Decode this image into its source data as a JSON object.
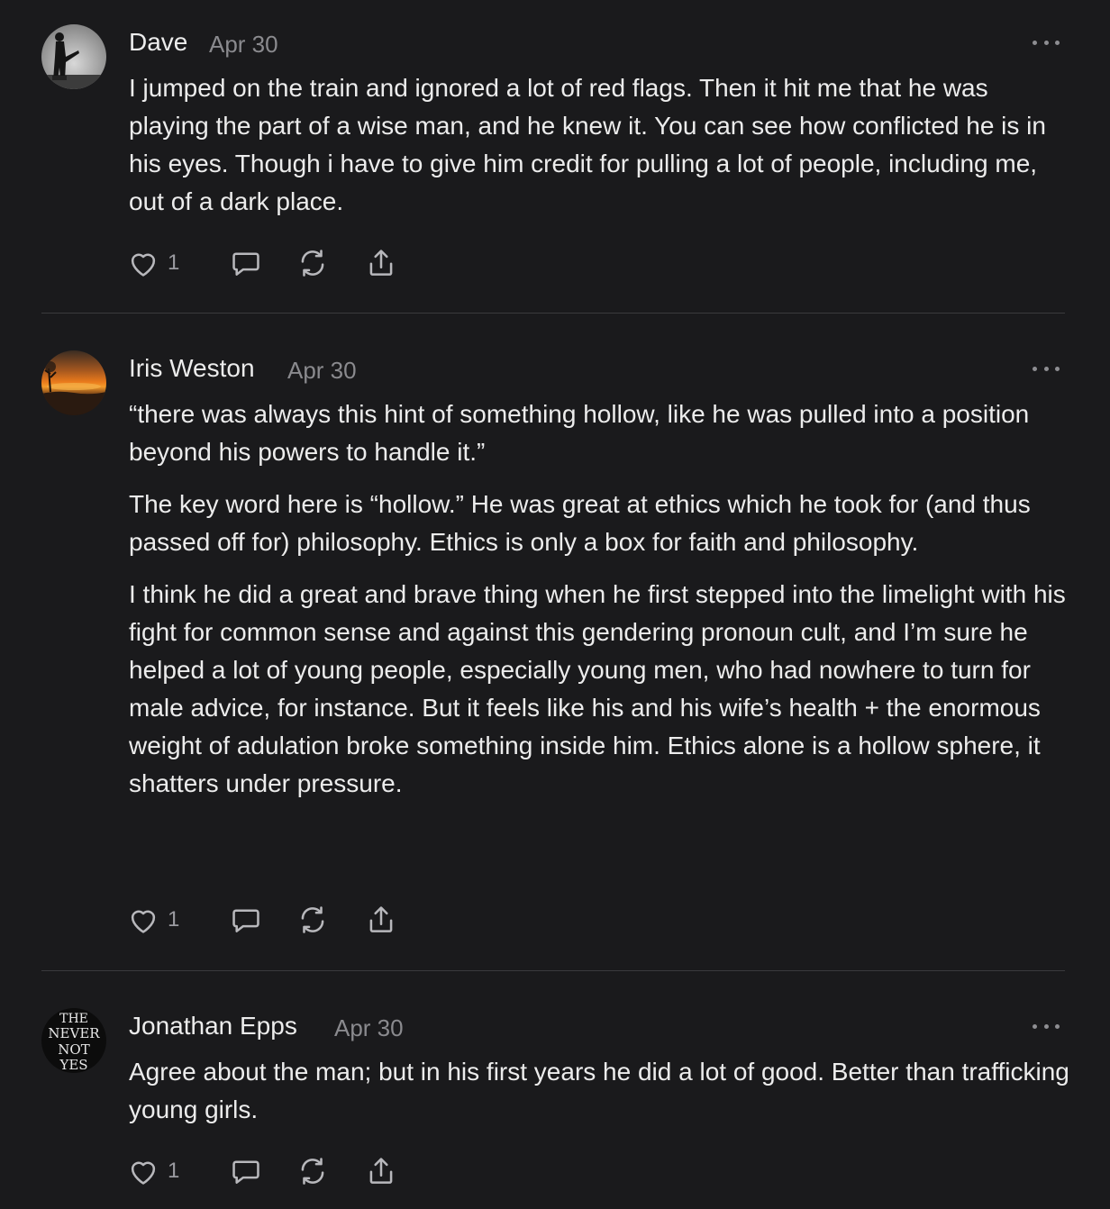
{
  "comments": [
    {
      "author": "Dave",
      "date": "Apr 30",
      "paragraphs": [
        "I jumped on the train and ignored a lot of red flags. Then it hit me that he was playing the part of a wise man, and he knew it. You can see how conflicted he is in his eyes. Though i have to give him credit for pulling a lot of people, including me, out of a dark place."
      ],
      "likes": "1"
    },
    {
      "author": "Iris Weston",
      "date": "Apr 30",
      "paragraphs": [
        "“there was always this hint of something hollow, like he was pulled into a position beyond his powers to handle it.”",
        "The key word here is “hollow.” He was great at ethics which he took for (and thus passed off for) philosophy. Ethics is only a box for faith and philosophy.",
        "I think he did a great and brave thing when he first stepped into the limelight with his fight for common sense and against this gendering pronoun cult, and I’m sure he helped a lot of young people, especially young men, who had nowhere to turn for male advice, for instance. But it feels like his and his wife’s health + the enormous weight of adulation broke something inside him. Ethics alone is a hollow sphere, it shatters under pressure."
      ],
      "likes": "1"
    },
    {
      "author": "Jonathan Epps",
      "date": "Apr 30",
      "avatar_text": [
        "THE",
        "NEVER",
        "NOT",
        "YES"
      ],
      "paragraphs": [
        "Agree about the man; but in his first years he did a lot of good. Better than trafficking young girls."
      ],
      "likes": "1"
    }
  ],
  "icons": [
    "heart-icon",
    "comment-icon",
    "restack-icon",
    "share-icon",
    "more-icon"
  ],
  "colors": {
    "background": "#1a1a1c",
    "text": "#ececec",
    "muted": "#8a8a8e",
    "divider": "#3a3a3d"
  }
}
